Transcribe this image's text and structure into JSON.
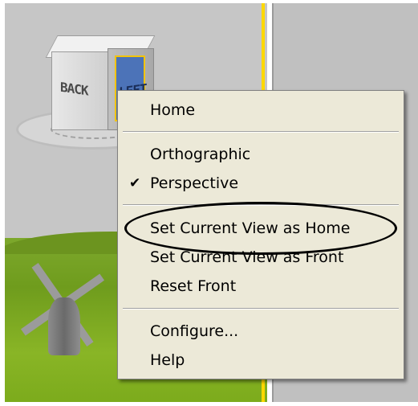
{
  "viewcube": {
    "face_back": "BACK",
    "face_left": "LEFT"
  },
  "context_menu": {
    "items": [
      {
        "label": "Home",
        "checked": false
      },
      {
        "label": "Orthographic",
        "checked": false
      },
      {
        "label": "Perspective",
        "checked": true
      },
      {
        "label": "Set Current View as Home",
        "checked": false
      },
      {
        "label": "Set Current View as Front",
        "checked": false
      },
      {
        "label": "Reset Front",
        "checked": false
      },
      {
        "label": "Configure...",
        "checked": false
      },
      {
        "label": "Help",
        "checked": false
      }
    ],
    "check_mark": "✔"
  },
  "colors": {
    "menu_background": "#ece9d8",
    "viewport_divider": "#ffd800",
    "selected_face": "#4c73b8"
  }
}
